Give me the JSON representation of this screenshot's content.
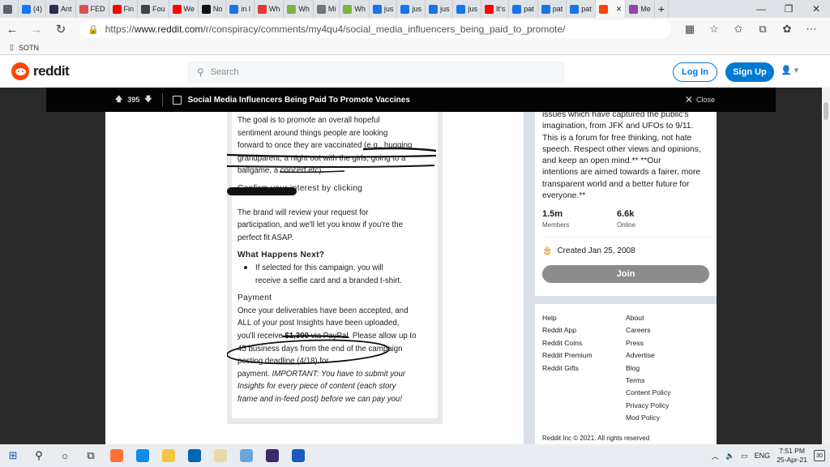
{
  "browser": {
    "tabs": [
      {
        "label": "",
        "color": "#5f6368"
      },
      {
        "label": "(4)",
        "color": "#1877f2"
      },
      {
        "label": "Ant",
        "color": "#2c2c54"
      },
      {
        "label": "FED",
        "color": "#d9534f"
      },
      {
        "label": "Fin",
        "color": "#ff0000"
      },
      {
        "label": "Fou",
        "color": "#444444"
      },
      {
        "label": "We",
        "color": "#ff0000"
      },
      {
        "label": "No",
        "color": "#111111"
      },
      {
        "label": "in l",
        "color": "#1a73e8"
      },
      {
        "label": "Wh",
        "color": "#e53935"
      },
      {
        "label": "Wh",
        "color": "#7cb342"
      },
      {
        "label": "Mi",
        "color": "#757575"
      },
      {
        "label": "Wh",
        "color": "#7cb342"
      },
      {
        "label": "jus",
        "color": "#1a73e8"
      },
      {
        "label": "jus",
        "color": "#1a73e8"
      },
      {
        "label": "jus",
        "color": "#1a73e8"
      },
      {
        "label": "jus",
        "color": "#1a73e8"
      },
      {
        "label": "It's",
        "color": "#ff0000"
      },
      {
        "label": "pat",
        "color": "#1a73e8"
      },
      {
        "label": "pat",
        "color": "#1a73e8"
      },
      {
        "label": "pat",
        "color": "#1a73e8"
      },
      {
        "label": "",
        "color": "#ff4500"
      },
      {
        "label": "Me",
        "color": "#8e44ad"
      }
    ],
    "active_tab_close": "✕",
    "new_tab": "+",
    "url_prefix": "https://",
    "url_domain": "www.reddit.com",
    "url_path": "/r/conspiracy/comments/my4qu4/social_media_influencers_being_paid_to_promote/",
    "favorite": "SOTN"
  },
  "reddit": {
    "logo_text": "reddit",
    "search_placeholder": "Search",
    "login": "Log In",
    "signup": "Sign Up"
  },
  "post": {
    "votes": "395",
    "title": "Social Media Influencers Being Paid To Promote Vaccines",
    "close": "Close"
  },
  "image_text": {
    "p1a": "The goal is to promote an overall hopeful",
    "p1b": "sentiment around things people are looking",
    "p1c": "forward to once they are vaccinated (e.g., hugging",
    "p1d": "grandparent, a night out with the girls, going to a",
    "p1e": "ballgame, a concert etc).",
    "confirm": "Confirm your interest by clicking",
    "p2a": "The brand will review your request for",
    "p2b": "participation, and we'll let you know if you're the",
    "p2c": "perfect fit ASAP.",
    "next_head": "What Happens Next?",
    "next_b1": "If selected for this campaign, you will",
    "next_b2": "receive a selfie card and a branded t-shirt.",
    "pay_head": "Payment",
    "pay1": "Once your deliverables have been accepted, and",
    "pay2": "ALL of your post Insights have been uploaded,",
    "pay3a": "you'll receive ",
    "pay3b": "$1,300",
    "pay3c": " via PayPal. Please allow up to",
    "pay4": "45 business days from the end of the campaign",
    "pay5": "posting deadline (4/18) for",
    "pay6a": "payment. ",
    "pay6b": "IMPORTANT: You have to submit your",
    "pay7": "Insights for every piece of content (each story",
    "pay8": "frame and in-feed post) before we can pay you!"
  },
  "sidebar": {
    "desc": [
      "issues which have captured the public's",
      "imagination, from JFK and UFOs to 9/11.",
      "This is a forum for free thinking, not hate",
      "speech. Respect other views and opinions,",
      "and keep an open mind.** **Our",
      "intentions are aimed towards a fairer, more",
      "transparent world and a better future for",
      "everyone.**"
    ],
    "members_num": "1.5m",
    "members_lbl": "Members",
    "online_num": "6.6k",
    "online_lbl": "Online",
    "created": "Created Jan 25, 2008",
    "join": "Join",
    "links_left": [
      "Help",
      "Reddit App",
      "Reddit Coins",
      "Reddit Premium",
      "Reddit Gifts"
    ],
    "links_right": [
      "About",
      "Careers",
      "Press",
      "Advertise",
      "Blog",
      "Terms",
      "Content Policy",
      "Privacy Policy",
      "Mod Policy"
    ],
    "copyright": "Reddit Inc © 2021. All rights reserved"
  },
  "taskbar": {
    "lang": "ENG",
    "time": "7:51 PM",
    "date": "25-Apr-21",
    "notif": "30",
    "apps": [
      "#ff7139",
      "#0c8ce9",
      "#f4c542",
      "#0364b8",
      "#e8d9a8",
      "#6ca6d9",
      "#3b2a6e",
      "#185abd"
    ]
  }
}
